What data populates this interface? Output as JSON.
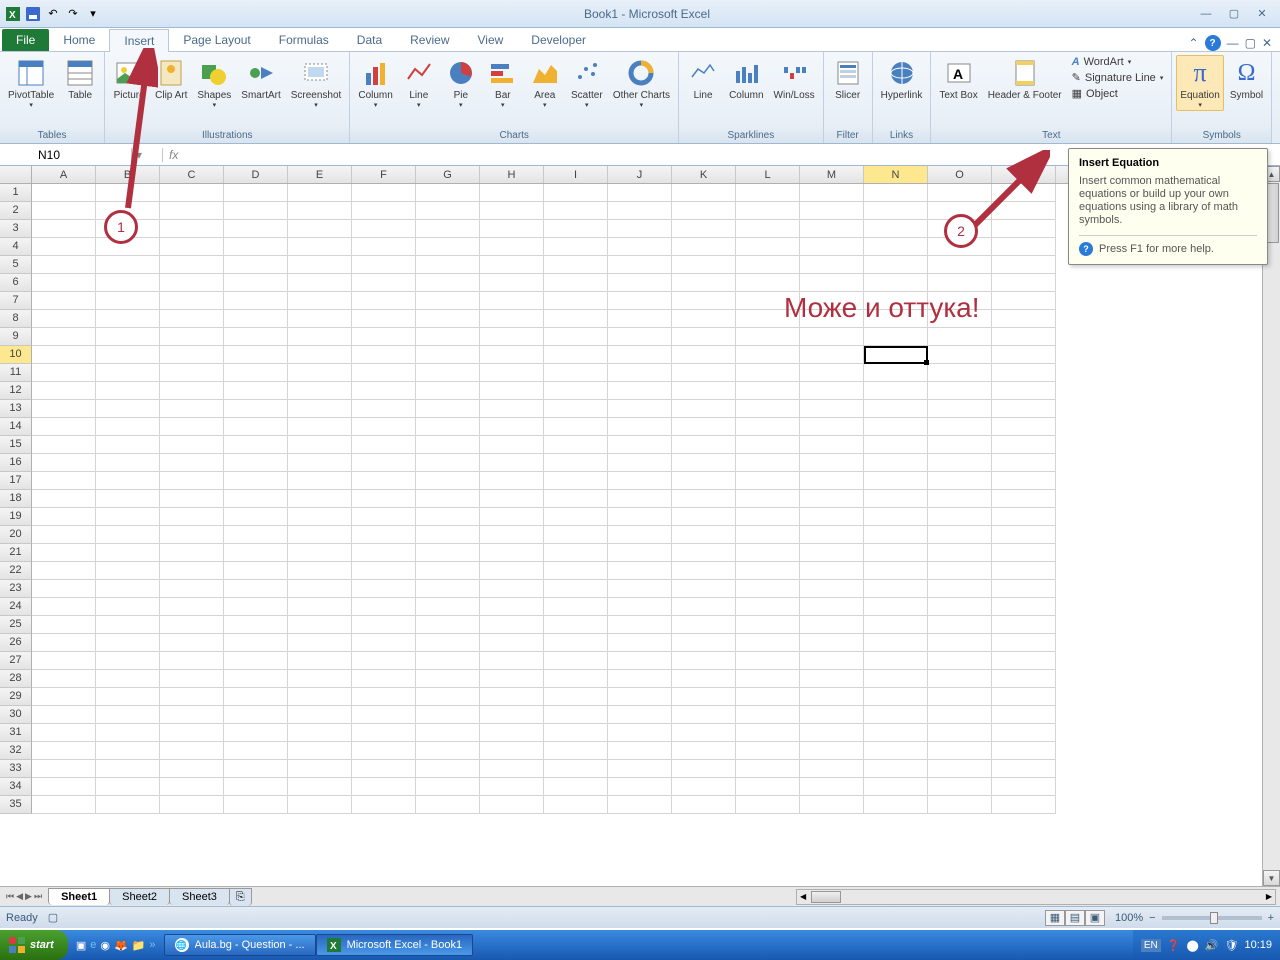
{
  "title": "Book1 - Microsoft Excel",
  "tabs": [
    "File",
    "Home",
    "Insert",
    "Page Layout",
    "Formulas",
    "Data",
    "Review",
    "View",
    "Developer"
  ],
  "active_tab": "Insert",
  "ribbon_groups": {
    "tables": {
      "label": "Tables",
      "items": [
        "PivotTable",
        "Table"
      ]
    },
    "illustrations": {
      "label": "Illustrations",
      "items": [
        "Picture",
        "Clip Art",
        "Shapes",
        "SmartArt",
        "Screenshot"
      ]
    },
    "charts": {
      "label": "Charts",
      "items": [
        "Column",
        "Line",
        "Pie",
        "Bar",
        "Area",
        "Scatter",
        "Other Charts"
      ]
    },
    "sparklines": {
      "label": "Sparklines",
      "items": [
        "Line",
        "Column",
        "Win/Loss"
      ]
    },
    "filter": {
      "label": "Filter",
      "items": [
        "Slicer"
      ]
    },
    "links": {
      "label": "Links",
      "items": [
        "Hyperlink"
      ]
    },
    "text": {
      "label": "Text",
      "items": [
        "Text Box",
        "Header & Footer"
      ],
      "rows": [
        "WordArt",
        "Signature Line",
        "Object"
      ]
    },
    "symbols": {
      "label": "Symbols",
      "items": [
        "Equation",
        "Symbol"
      ]
    }
  },
  "namebox": "N10",
  "fx_label": "fx",
  "columns": [
    "A",
    "B",
    "C",
    "D",
    "E",
    "F",
    "G",
    "H",
    "I",
    "J",
    "K",
    "L",
    "M",
    "N",
    "O",
    "P"
  ],
  "rows_count": 35,
  "selected_col": "N",
  "selected_row": 10,
  "tooltip": {
    "title": "Insert Equation",
    "body": "Insert common mathematical equations or build up your own equations using a library of math symbols.",
    "help": "Press F1 for more help."
  },
  "annotation_text": "Може и оттука!",
  "anno1": "1",
  "anno2": "2",
  "sheets": [
    "Sheet1",
    "Sheet2",
    "Sheet3"
  ],
  "status": "Ready",
  "zoom": "100%",
  "taskbar": {
    "start": "start",
    "items": [
      "Aula.bg - Question - ...",
      "Microsoft Excel - Book1"
    ],
    "clock": "10:19"
  }
}
